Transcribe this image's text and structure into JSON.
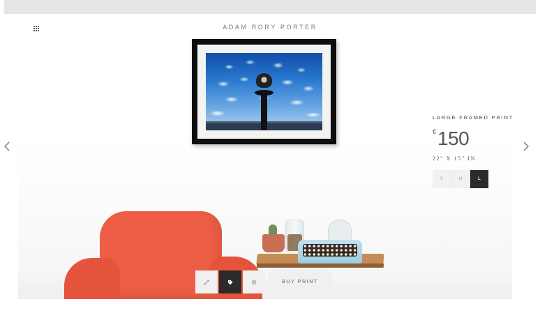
{
  "header": {
    "brand": "ADAM RORY PORTER",
    "menu_icon": "grid-icon"
  },
  "product": {
    "type": "LARGE FRAMED PRINT",
    "currency": "€",
    "price": "150",
    "dimensions": "22\" X 15\" IN.",
    "sizes": [
      {
        "label": "S",
        "selected": false
      },
      {
        "label": "M",
        "selected": false
      },
      {
        "label": "L",
        "selected": true
      }
    ]
  },
  "navigation": {
    "prev_icon": "chevron-left-icon",
    "next_icon": "chevron-right-icon"
  },
  "toolbar": {
    "items": [
      {
        "icon": "expand-icon",
        "active": false
      },
      {
        "icon": "tag-icon",
        "active": true
      },
      {
        "icon": "menu-lines-icon",
        "active": false
      }
    ],
    "buy_label": "BUY PRINT"
  },
  "colors": {
    "accent_dark": "#2b2b2b",
    "chair": "#ee5d45",
    "frame": "#0d0d0d"
  }
}
